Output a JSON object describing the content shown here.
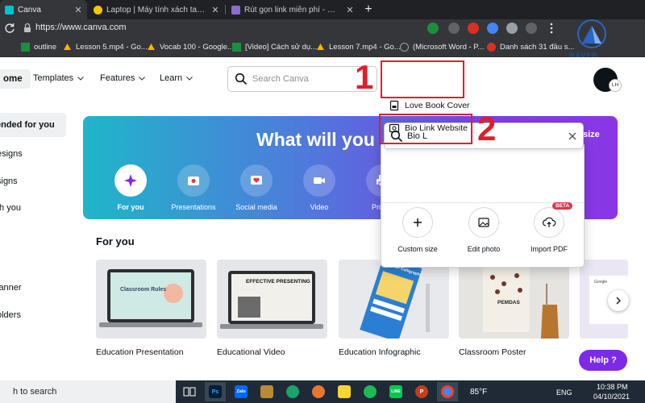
{
  "browser": {
    "tabs": [
      {
        "title": "Canva",
        "active": true
      },
      {
        "title": "Laptop | Máy tính xách tay mua",
        "active": false
      },
      {
        "title": "Rút gọn link miễn phí - Web rút",
        "active": false
      }
    ],
    "new_tab_glyph": "+",
    "url": "https://www.canva.com",
    "bookmarks": [
      {
        "label": "outline",
        "icon": "sheets-icon",
        "color": "#1e8e3e"
      },
      {
        "label": "Lesson 5.mp4 - Go...",
        "icon": "drive-icon",
        "color": "#f4b400"
      },
      {
        "label": "Vocab 100 - Google...",
        "icon": "drive-icon",
        "color": "#f4b400"
      },
      {
        "label": "[Video] Cách sử dụ...",
        "icon": "sheets-icon",
        "color": "#1e8e3e"
      },
      {
        "label": "Lesson 7.mp4 - Go...",
        "icon": "drive-icon",
        "color": "#f4b400"
      },
      {
        "label": "(Microsoft Word - P...",
        "icon": "globe-icon",
        "color": "#9aa0a6"
      },
      {
        "label": "Danh sách 31 đầu s...",
        "icon": "red-circle-icon",
        "color": "#d93025"
      }
    ]
  },
  "canva": {
    "nav": {
      "home": "ome",
      "templates": "Templates",
      "features": "Features",
      "learn": "Learn",
      "search_placeholder": "Search Canva",
      "avatar_initials": "LH"
    },
    "sidebar": [
      {
        "label": "ended for you",
        "active": true
      },
      {
        "label": "esigns",
        "active": false
      },
      {
        "label": "signs",
        "active": false
      },
      {
        "label": "th you",
        "active": false
      },
      {
        "label": "t",
        "active": false
      },
      {
        "label": "lanner",
        "active": false
      },
      {
        "label": "olders",
        "active": false
      }
    ],
    "hero": {
      "title": "What will you",
      "size_button": "size",
      "categories": [
        {
          "label": "For you",
          "icon": "sparkle-icon",
          "selected": true
        },
        {
          "label": "Presentations",
          "icon": "presentation-icon",
          "selected": false
        },
        {
          "label": "Social media",
          "icon": "heart-icon",
          "selected": false
        },
        {
          "label": "Video",
          "icon": "video-icon",
          "selected": false
        },
        {
          "label": "Print p",
          "icon": "printer-icon",
          "selected": false
        }
      ]
    },
    "for_you": {
      "heading": "For you",
      "cards": [
        {
          "label": "Education Presentation",
          "thumb_text": "Classroom Rules"
        },
        {
          "label": "Educational Video",
          "thumb_text": "EFFECTIVE PRESENTING"
        },
        {
          "label": "Education Infographic",
          "thumb_text": "THE ART OF Calligraphy"
        },
        {
          "label": "Classroom Poster",
          "thumb_text": "PEMDAS"
        },
        {
          "label": "",
          "thumb_text": "Google"
        }
      ]
    },
    "help_button": "Help ?",
    "search_dropdown": {
      "query": "Bio L",
      "suggestions": [
        "Love Book Cover",
        "Bio Link Website"
      ],
      "actions": [
        {
          "label": "Custom size",
          "icon": "plus-icon"
        },
        {
          "label": "Edit photo",
          "icon": "photo-edit-icon"
        },
        {
          "label": "Import PDF",
          "icon": "cloud-upload-icon",
          "badge": "BETA"
        }
      ]
    },
    "annotations": [
      "1",
      "2"
    ]
  },
  "watermark": {
    "text": "RAVEB"
  },
  "taskbar": {
    "search_text": "h to search",
    "apps": [
      {
        "name": "task-view-icon",
        "label": ""
      },
      {
        "name": "photoshop-icon",
        "label": "Ps"
      },
      {
        "name": "zalo-icon",
        "label": "Zalo"
      },
      {
        "name": "mail-icon",
        "label": ""
      },
      {
        "name": "edge-icon",
        "label": ""
      },
      {
        "name": "chrome-alt-icon",
        "label": ""
      },
      {
        "name": "notes-icon",
        "label": ""
      },
      {
        "name": "spotify-icon",
        "label": ""
      },
      {
        "name": "line-icon",
        "label": "LINE"
      },
      {
        "name": "powerpoint-icon",
        "label": "P"
      },
      {
        "name": "chrome-icon",
        "label": ""
      }
    ],
    "weather": "85°F",
    "language": "ENG",
    "time": "10:38 PM",
    "date": "04/10/2021"
  }
}
